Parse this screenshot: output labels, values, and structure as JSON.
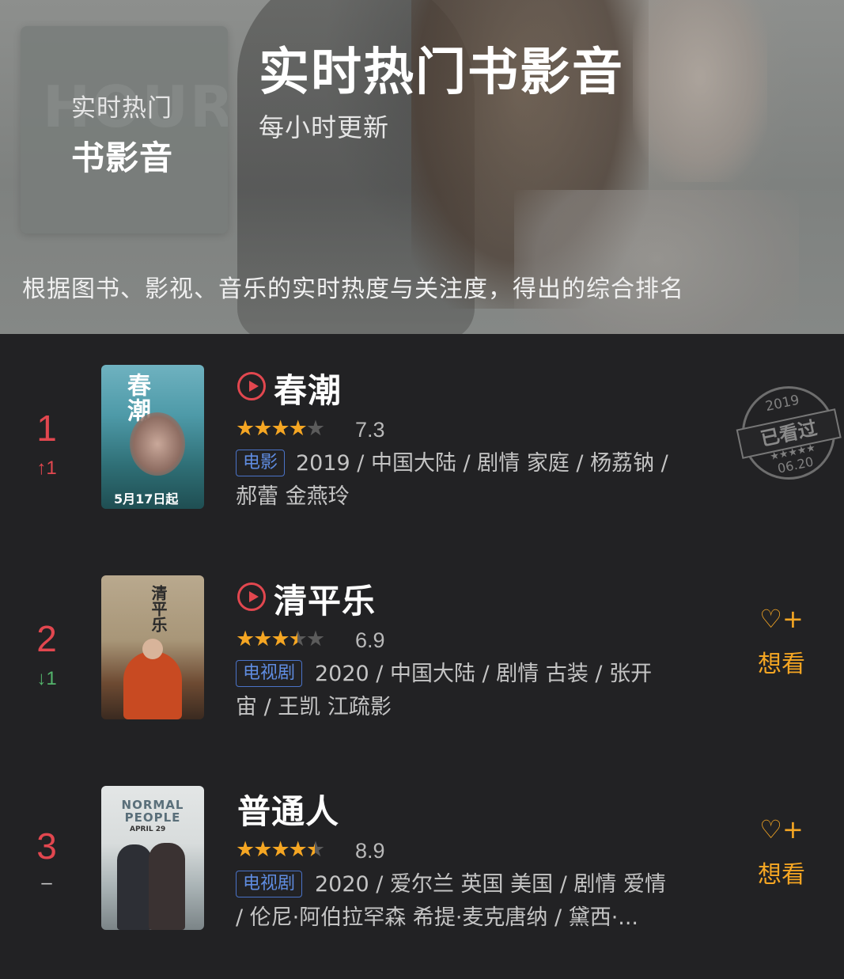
{
  "header": {
    "badge_watermark": "HOUR",
    "badge_line1": "实时热门",
    "badge_line2": "书影音",
    "title": "实时热门书影音",
    "subtitle": "每小时更新",
    "description": "根据图书、影视、音乐的实时热度与关注度，得出的综合排名"
  },
  "items": [
    {
      "rank": "1",
      "change": "↑1",
      "change_dir": "up",
      "title": "春潮",
      "has_play": true,
      "stars_value": 4,
      "score": "7.3",
      "tag": "电影",
      "meta_line1": "2019 / 中国大陆 / 剧情 家庭 / 杨荔钠 /",
      "meta_line2": "郝蕾 金燕玲",
      "poster_title": "春潮",
      "poster_date": "5月17日起",
      "status": "watched",
      "stamp": {
        "year": "2019",
        "label": "已看过",
        "stars": "★★★★★",
        "date": "06.20"
      }
    },
    {
      "rank": "2",
      "change": "↓1",
      "change_dir": "down",
      "title": "清平乐",
      "has_play": true,
      "stars_value": 3.5,
      "score": "6.9",
      "tag": "电视剧",
      "meta_line1": "2020 / 中国大陆 / 剧情 古装 / 张开",
      "meta_line2": "宙 / 王凯 江疏影",
      "poster_title": "清平乐",
      "status": "want",
      "want_label": "想看"
    },
    {
      "rank": "3",
      "change": "–",
      "change_dir": "flat",
      "title": "普通人",
      "has_play": false,
      "stars_value": 4.5,
      "score": "8.9",
      "tag": "电视剧",
      "meta_line1": "2020 / 爱尔兰 英国 美国 / 剧情 爱情",
      "meta_line2": "/ 伦尼·阿伯拉罕森 希提·麦克唐纳 / 黛西·...",
      "poster_title": "NORMAL PEOPLE",
      "poster_date": "APRIL 29",
      "status": "want",
      "want_label": "想看"
    }
  ],
  "colors": {
    "accent_red": "#e2474f",
    "down_green": "#53b36b",
    "star_gold": "#f5a623",
    "tag_blue": "#5f8ce0",
    "background": "#222224"
  },
  "icons": {
    "play": "play-circle-icon",
    "want": "heart-plus-icon",
    "watched_stamp": "watched-stamp-icon"
  }
}
